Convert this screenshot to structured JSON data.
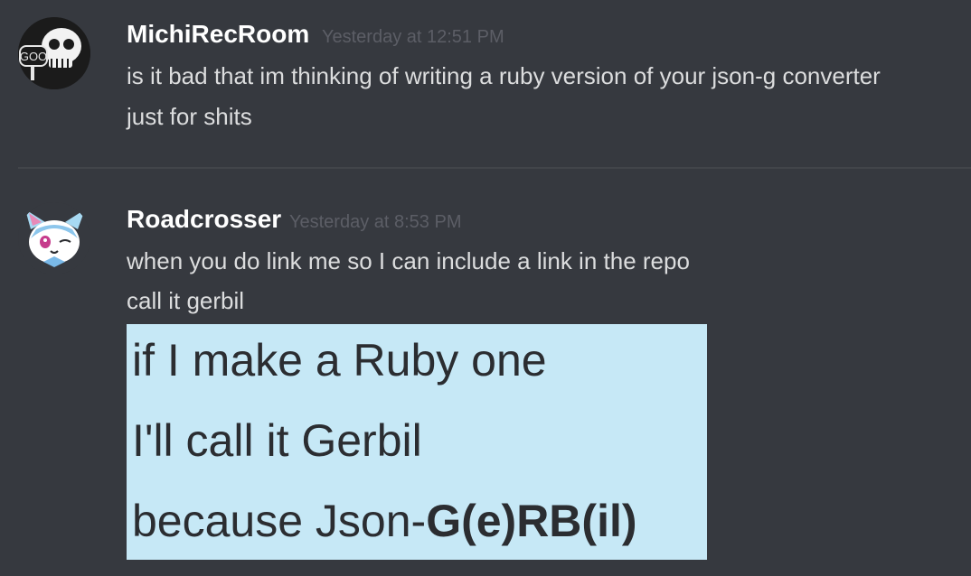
{
  "messages": [
    {
      "username": "MichiRecRoom",
      "timestamp": "Yesterday at 12:51 PM",
      "lines": [
        "is it bad that im thinking of writing a ruby version of your json-g converter",
        "just for shits"
      ],
      "avatar_text": "GOO"
    },
    {
      "username": "Roadcrosser",
      "timestamp": "Yesterday at 8:53 PM",
      "lines": [
        "when you do link me so I can include a link in the repo",
        "call it gerbil"
      ],
      "attachment": {
        "line1": "if I make a Ruby one",
        "line2": "I'll call it Gerbil",
        "line3_plain": "because Json-",
        "line3_bold": "G(e)RB(il)"
      }
    }
  ],
  "colors": {
    "background": "#36393f",
    "username": "#ffffff",
    "timestamp": "#5c5e66",
    "message_text": "#dcddde",
    "attachment_bg": "#c6e8f6"
  }
}
